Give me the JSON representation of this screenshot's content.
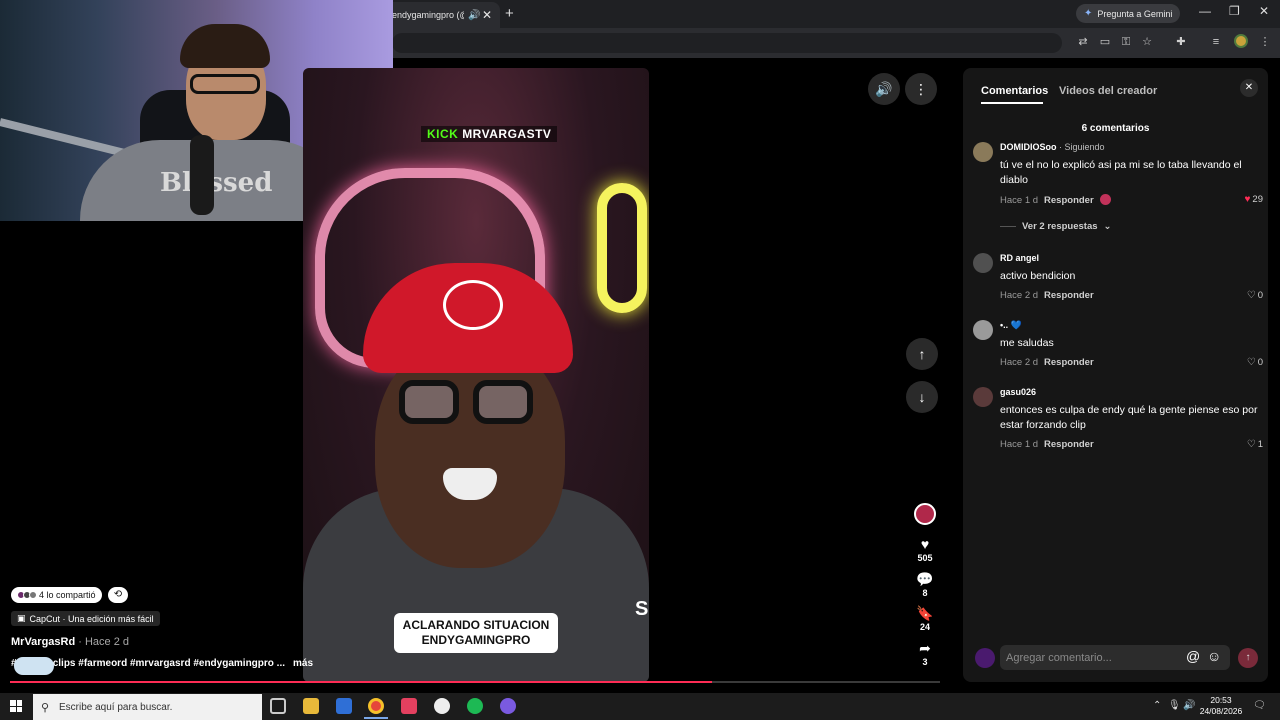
{
  "browser": {
    "tab_title": "endygamingpro (@en",
    "gemini_label": "Pregunta a Gemini",
    "win_min": "—",
    "win_max": "❐",
    "win_close": "✕"
  },
  "video": {
    "watermark_brand": "KICK",
    "watermark_channel": "MRVARGASTV",
    "caption_line1": "ACLARANDO SITUACION",
    "caption_line2": "ENDYGAMINGPRO",
    "edge_letter": "S",
    "progress_fraction": 0.755
  },
  "controls": {
    "sound_icon": "speaker-icon",
    "more_icon": "more-vertical-icon",
    "up_icon": "arrow-up-icon",
    "down_icon": "arrow-down-icon"
  },
  "actions": {
    "likes": "505",
    "comments": "8",
    "saves": "24",
    "shares": "3"
  },
  "post": {
    "shared_text": "4 lo compartió",
    "capcut_text": "CapCut · Una edición más fácil",
    "author": "MrVargasRd",
    "ago": " · Hace 2 d",
    "hashtags": "# s #kickclips #farmeord #mrvargasrd #endygamingpro ...",
    "more": "más"
  },
  "panel": {
    "tab_comments": "Comentarios",
    "tab_creator": "Videos del creador",
    "count_text": "6 comentarios",
    "view_replies": "Ver 2 respuestas",
    "reply_label": "Responder",
    "input_placeholder": "Agregar comentario...",
    "comments": [
      {
        "user": "DOMIDIOSoo",
        "follow": " · Siguiendo",
        "text": "tú ve el no lo explicó asi pa mi se lo taba llevando el diablo",
        "ago": "Hace 1 d",
        "likes": "29",
        "liked": true,
        "avatar_color": "#8a7a5a"
      },
      {
        "user": "RD angel",
        "follow": "",
        "text": "activo bendicion",
        "ago": "Hace 2 d",
        "likes": "0",
        "liked": false,
        "avatar_color": "#505050"
      },
      {
        "user": "•.. 💙",
        "follow": "",
        "text": "me saludas",
        "ago": "Hace 2 d",
        "likes": "0",
        "liked": false,
        "avatar_color": "#9a9a9a"
      },
      {
        "user": "gasu026",
        "follow": "",
        "text": "entonces es culpa de endy qué la gente piense eso por estar forzando clip",
        "ago": "Hace 1 d",
        "likes": "1",
        "liked": false,
        "avatar_color": "#5a3a3a"
      }
    ]
  },
  "taskbar": {
    "search_placeholder": "Escribe aquí para buscar.",
    "time": "20:53",
    "date": "24/08/2026"
  },
  "colors": {
    "accent": "#fe2c55",
    "kick_green": "#53fc18",
    "panel_bg": "#161616"
  }
}
